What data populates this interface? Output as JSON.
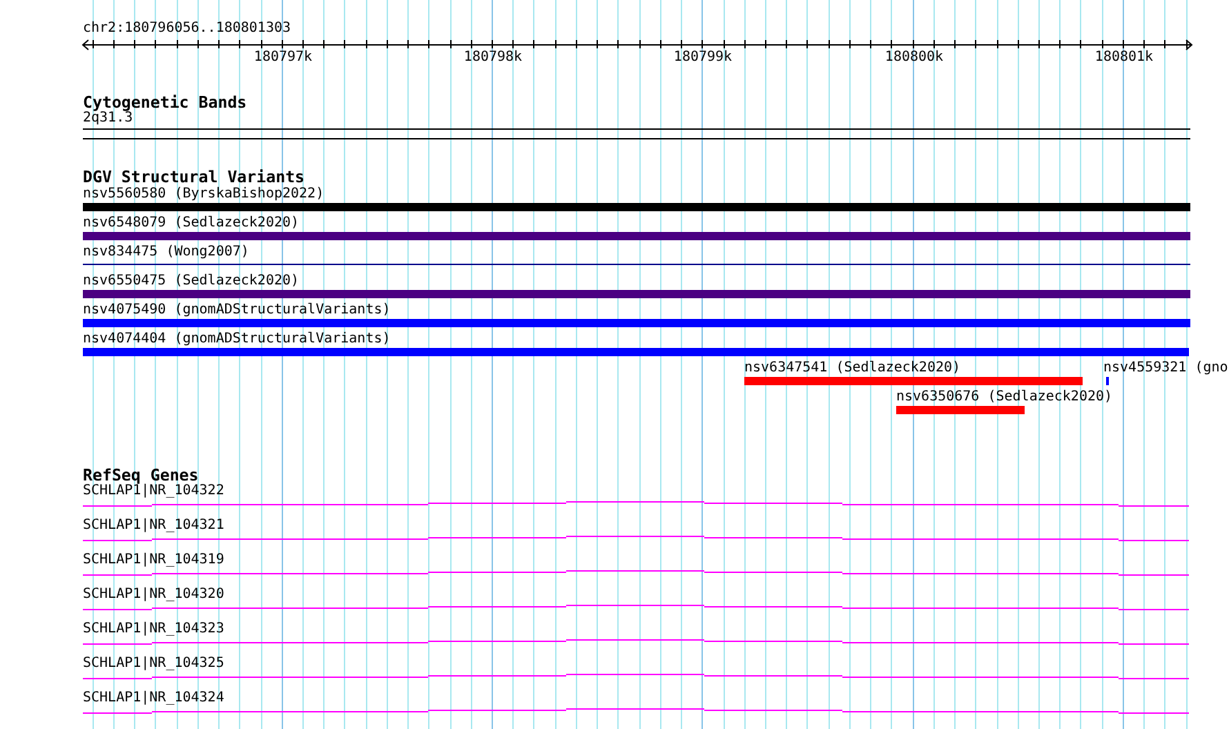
{
  "ruler": {
    "label": "chr2:180796056..180801303",
    "tick_labels": [
      "180797k",
      "180798k",
      "180799k",
      "180800k",
      "180801k"
    ]
  },
  "cytogenetic_bands": {
    "title": "Cytogenetic Bands",
    "band": "2q31.3"
  },
  "dgv_structural_variants": {
    "title": "DGV Structural Variants",
    "rows": [
      [
        {
          "label": "nsv5560580 (ByrskaBishop2022)",
          "color": "#000000",
          "kind": "bar"
        }
      ],
      [
        {
          "label": "nsv6548079 (Sedlazeck2020)",
          "color": "#4b0082",
          "kind": "bar"
        }
      ],
      [
        {
          "label": "nsv834475 (Wong2007)",
          "color": "#00008b",
          "kind": "line"
        }
      ],
      [
        {
          "label": "nsv6550475 (Sedlazeck2020)",
          "color": "#4b0082",
          "kind": "bar"
        }
      ],
      [
        {
          "label": "nsv4075490 (gnomADStructuralVariants)",
          "color": "#0000ff",
          "kind": "bar"
        }
      ],
      [
        {
          "label": "nsv4074404 (gnomADStructuralVariants)",
          "color": "#0000ff",
          "kind": "bar"
        }
      ],
      [
        {
          "label": "nsv6347541 (Sedlazeck2020)",
          "color": "#ff0000",
          "kind": "bar"
        },
        {
          "label": "nsv4559321 (gno",
          "color": "#0000ff",
          "kind": "bar"
        }
      ],
      [
        {
          "label": "nsv6350676 (Sedlazeck2020)",
          "color": "#ff0000",
          "kind": "bar"
        }
      ]
    ]
  },
  "refseq_genes": {
    "title": "RefSeq Genes",
    "genes": [
      "SCHLAP1|NR_104322",
      "SCHLAP1|NR_104321",
      "SCHLAP1|NR_104319",
      "SCHLAP1|NR_104320",
      "SCHLAP1|NR_104323",
      "SCHLAP1|NR_104325",
      "SCHLAP1|NR_104324"
    ]
  }
}
